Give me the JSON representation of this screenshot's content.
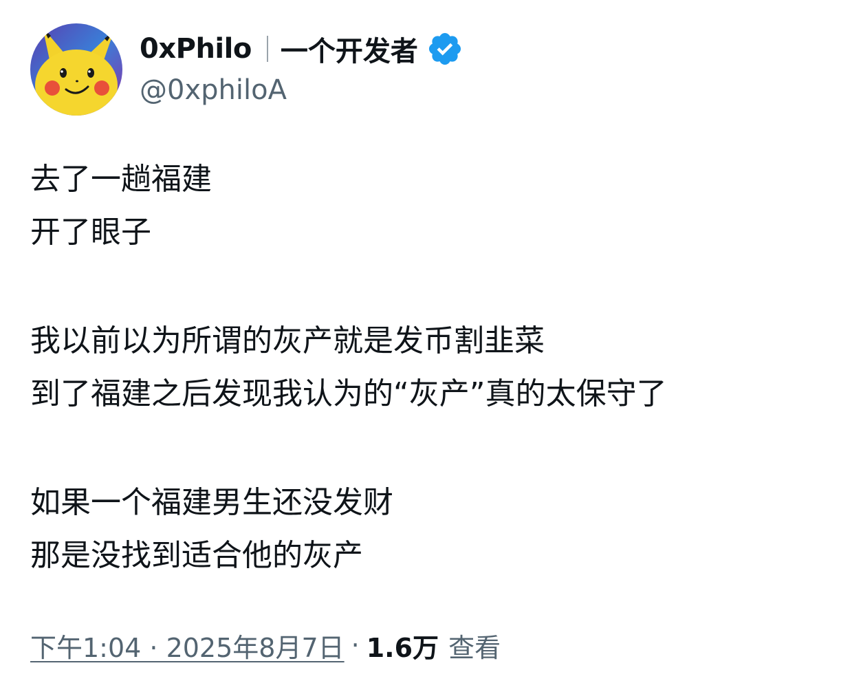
{
  "author": {
    "display_name": "0xPhilo",
    "display_name_cn": "一个开发者",
    "handle": "@0xphiloA",
    "verified": true
  },
  "tweet": {
    "lines": [
      "去了一趟福建",
      "开了眼子",
      "",
      "我以前以为所谓的灰产就是发币割韭菜",
      "到了福建之后发现我认为的“灰产”真的太保守了",
      "",
      "如果一个福建男生还没发财",
      "那是没找到适合他的灰产"
    ]
  },
  "meta": {
    "timestamp": "下午1:04 · 2025年8月7日",
    "separator": "·",
    "views_count": "1.6万",
    "views_label": "查看"
  },
  "colors": {
    "text_primary": "#0f1419",
    "text_secondary": "#536471",
    "verified_blue": "#1d9bf0"
  }
}
